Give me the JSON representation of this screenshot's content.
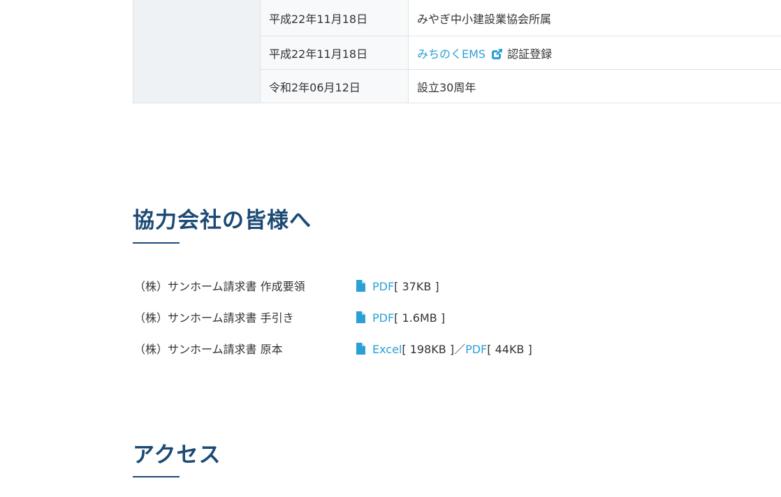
{
  "history": {
    "rows": [
      {
        "date": "平成22年11月18日",
        "event": "みやぎ中小建設業協会所属",
        "link_text": "",
        "suffix": ""
      },
      {
        "date": "平成22年11月18日",
        "event": "",
        "link_text": "みちのくEMS",
        "suffix": "認証登録"
      },
      {
        "date": "令和2年06月12日",
        "event": "設立30周年",
        "link_text": "",
        "suffix": ""
      }
    ]
  },
  "partners": {
    "heading": "協力会社の皆様へ",
    "documents": [
      {
        "name": "（株）サンホーム請求書 作成要領",
        "file1_label": "PDF",
        "file1_size": "[ 37KB ]"
      },
      {
        "name": "（株）サンホーム請求書 手引き",
        "file1_label": "PDF",
        "file1_size": "[ 1.6MB ]"
      },
      {
        "name": "（株）サンホーム請求書 原本",
        "file1_label": "Excel",
        "file1_size": "[ 198KB ]",
        "separator": "／",
        "file2_label": "PDF",
        "file2_size": "[ 44KB ]"
      }
    ]
  },
  "access": {
    "heading": "アクセス"
  },
  "icons": {
    "external_link": "external-link-icon",
    "file": "file-icon"
  },
  "colors": {
    "heading": "#1c4a74",
    "link": "#2aa0d6",
    "label_cell_bg": "#eef2f4",
    "date_cell_bg": "#f7f9fa",
    "border": "#dfe3e6"
  }
}
